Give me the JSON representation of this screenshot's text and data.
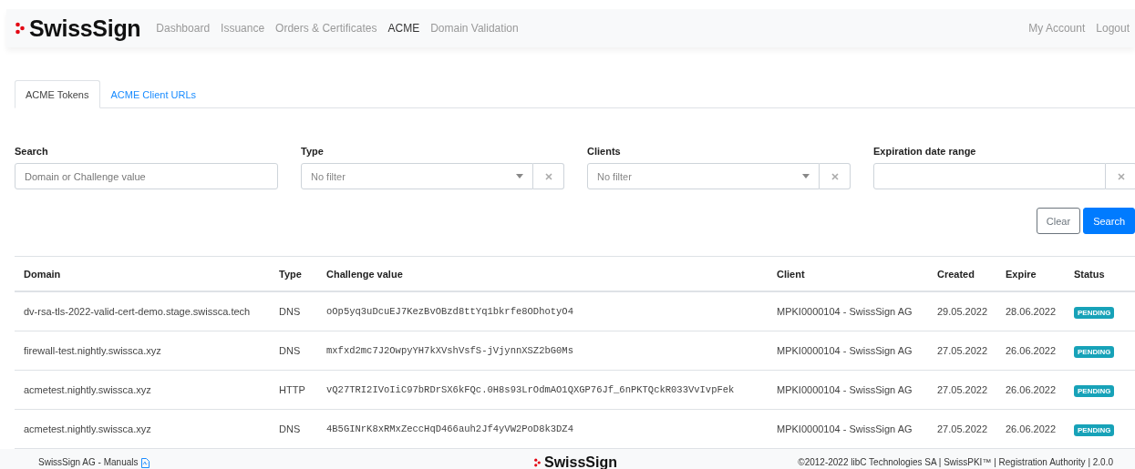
{
  "navbar": {
    "brand": "SwissSign",
    "items": [
      {
        "label": "Dashboard",
        "selected": false
      },
      {
        "label": "Issuance",
        "selected": false
      },
      {
        "label": "Orders & Certificates",
        "selected": false
      },
      {
        "label": "ACME",
        "selected": true
      },
      {
        "label": "Domain Validation",
        "selected": false
      }
    ],
    "account_links": [
      "My Account",
      "Logout"
    ]
  },
  "tabs": [
    {
      "label": "ACME Tokens",
      "selected": true
    },
    {
      "label": "ACME Client URLs",
      "selected": false
    }
  ],
  "filters": [
    {
      "kind": "text",
      "label": "Search",
      "placeholder": "Domain or Challenge value"
    },
    {
      "kind": "select",
      "label": "Type",
      "placeholder": "No filter"
    },
    {
      "kind": "select",
      "label": "Clients",
      "placeholder": "No filter"
    },
    {
      "kind": "daterange",
      "label": "Expiration date range"
    }
  ],
  "buttons": [
    {
      "kind": "secondary",
      "label": "Clear"
    },
    {
      "kind": "primary",
      "label": "Search"
    }
  ],
  "table": {
    "columns": [
      "Domain",
      "Type",
      "Challenge value",
      "Client",
      "Created",
      "Expire",
      "Status"
    ],
    "rows": [
      [
        "dv-rsa-tls-2022-valid-cert-demo.stage.swissca.tech",
        "DNS",
        "oOp5yq3uDcuEJ7KezBvOBzd8ttYq1bkrfe8ODhotyO4",
        "MPKI0000104 - SwissSign AG",
        "29.05.2022",
        "28.06.2022",
        "PENDING"
      ],
      [
        "firewall-test.nightly.swissca.xyz",
        "DNS",
        "mxfxd2mc7J2OwpyYH7kXVshVsfS-jVjynnXSZ2bG0Ms",
        "MPKI0000104 - SwissSign AG",
        "27.05.2022",
        "26.06.2022",
        "PENDING"
      ],
      [
        "acmetest.nightly.swissca.xyz",
        "HTTP",
        "vQ27TRI2IVoIiC97bRDrSX6kFQc.0H8s93LrOdmAO1QXGP76Jf_6nPKTQckR033VvIvpFek",
        "MPKI0000104 - SwissSign AG",
        "27.05.2022",
        "26.06.2022",
        "PENDING"
      ],
      [
        "acmetest.nightly.swissca.xyz",
        "DNS",
        "4B5GINrK8xRMxZeccHqD466auh2Jf4yVW2PoD8k3DZ4",
        "MPKI0000104 - SwissSign AG",
        "27.05.2022",
        "26.06.2022",
        "PENDING"
      ]
    ]
  },
  "footer": {
    "manuals": "SwissSign AG - Manuals",
    "brand": "SwissSign",
    "copyright": "©2012-2022 libC Technologies SA | SwissPKI™ | Registration Authority | 2.0.0"
  }
}
